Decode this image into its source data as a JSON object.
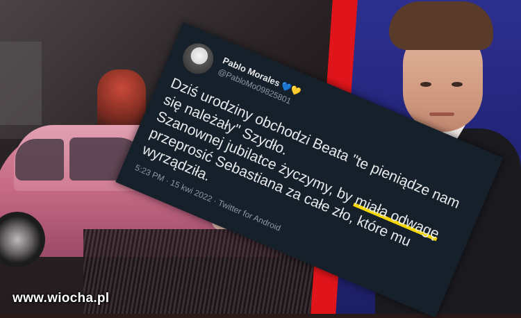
{
  "tweet": {
    "display_name": "Pablo Morales",
    "name_emojis": "💙💛",
    "handle": "@PabloMo09825801",
    "text_line1": "Dziś urodziny obchodzi Beata \"te pieniądze nam się należały\" Szydło.",
    "text_line2_before": "Szanownej jubilatce życzymy, by ",
    "text_highlight": "miała odwagę",
    "text_line2_after": " przeprosić Sebastiana za całe zło, które mu wyrządziła.",
    "timestamp": "5:23 PM · 15 kwi 2022 · Twitter for Android",
    "highlight_color": "#f3d600"
  },
  "watermark": "www.wiocha.pl",
  "colors": {
    "tweet_bg": "#15202b",
    "accent_red": "#e0151b"
  }
}
